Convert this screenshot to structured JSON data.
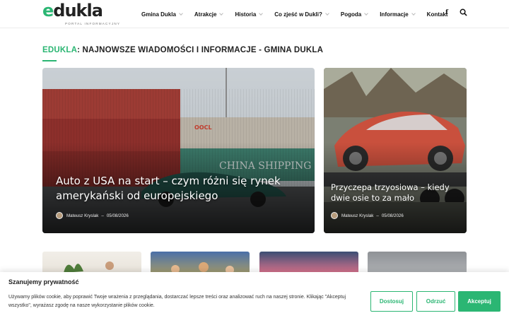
{
  "header": {
    "logo_text_e": "e",
    "logo_text_rest": "dukla",
    "logo_subtitle": "PORTAL INFORMACYJNY",
    "nav": [
      {
        "label": "Gmina Dukla",
        "dropdown": true
      },
      {
        "label": "Atrakcje",
        "dropdown": true
      },
      {
        "label": "Historia",
        "dropdown": true
      },
      {
        "label": "Co zjeść w Dukli?",
        "dropdown": true
      },
      {
        "label": "Pogoda",
        "dropdown": true
      },
      {
        "label": "Informacje",
        "dropdown": true
      },
      {
        "label": "Kontakt",
        "dropdown": false
      }
    ],
    "facebook_icon": "f"
  },
  "section": {
    "brand": "EDUKLA",
    "title_rest": ": NAJNOWSZE WIADOMOŚCI I INFORMACJE - GMINA DUKLA"
  },
  "articles": [
    {
      "title": "Auto z USA na start – czym różni się rynek amerykański od europejskiego",
      "author": "Mateusz Kryslak",
      "separator": "–",
      "date": "05/08/2026"
    },
    {
      "title": "Przyczepa trzyosiowa – kiedy dwie osie to za mało",
      "author": "Mateusz Kryslak",
      "separator": "–",
      "date": "05/08/2026"
    }
  ],
  "cookie": {
    "title": "Szanujemy prywatność",
    "text": "Używamy plików cookie, aby poprawić Twoje wrażenia z przeglądania, dostarczać lepsze treści oraz analizować ruch na naszej stronie. Klikając \"Akceptuj wszystko\", wyrażasz zgodę na nasze wykorzystanie plików cookie.",
    "btn_customize": "Dostosuj",
    "btn_reject": "Odrzuć",
    "btn_accept": "Akceptuj"
  },
  "colors": {
    "accent": "#2bb673",
    "text": "#222222"
  }
}
